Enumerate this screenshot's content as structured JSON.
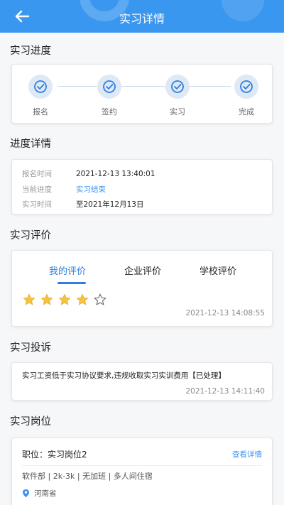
{
  "header": {
    "title": "实习详情"
  },
  "progress": {
    "title": "实习进度",
    "steps": [
      {
        "label": "报名",
        "done": true
      },
      {
        "label": "签约",
        "done": true
      },
      {
        "label": "实习",
        "done": true
      },
      {
        "label": "完成",
        "done": true
      }
    ]
  },
  "details": {
    "title": "进度详情",
    "rows": [
      {
        "key": "报名时间",
        "value": "2021-12-13 13:40:01"
      },
      {
        "key": "当前进度",
        "value": "实习结束"
      },
      {
        "key": "实习时间",
        "value": "至2021年12月13日"
      }
    ]
  },
  "evaluation": {
    "title": "实习评价",
    "tabs": [
      "我的评价",
      "企业评价",
      "学校评价"
    ],
    "active_tab": 0,
    "rating": 4,
    "max_rating": 5,
    "time": "2021-12-13 14:08:55",
    "star_color": "#f5c242"
  },
  "complaint": {
    "title": "实习投诉",
    "text": "实习工资低于实习协议要求,违规收取实习实训费用【已处理】",
    "time": "2021-12-13 14:11:40"
  },
  "position": {
    "title": "实习岗位",
    "name": "职位：实习岗位2",
    "link": "查看详情",
    "tags": "软件部 | 2k-3k | 无加班 | 多人间住宿",
    "location": "河南省"
  },
  "colors": {
    "accent": "#3a97f0"
  }
}
